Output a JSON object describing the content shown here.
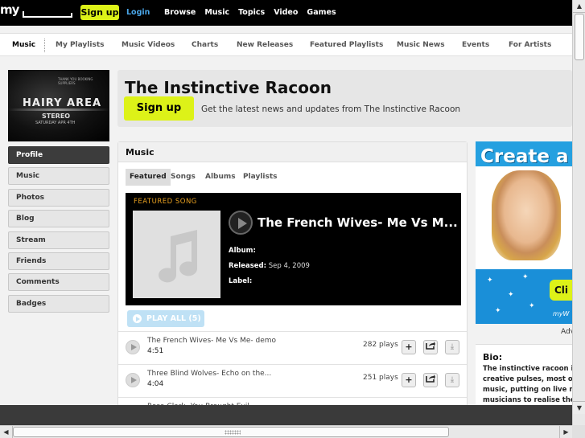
{
  "topbar": {
    "logo": "my",
    "signup_label": "Sign up",
    "login_label": "Login",
    "nav": [
      "Browse",
      "Music",
      "Topics",
      "Video",
      "Games"
    ]
  },
  "subnav": {
    "items": [
      "Music",
      "My Playlists",
      "Music Videos",
      "Charts",
      "New Releases",
      "Featured Playlists",
      "Music News",
      "Events",
      "For Artists"
    ]
  },
  "profile_image": {
    "line1": "HAIRY AREA",
    "line2": "STEREO",
    "line3": "SATURDAY APR 4TH",
    "line4": "THANK YOU BOOKING SUPPLIERS"
  },
  "sidemenu": {
    "items": [
      "Profile",
      "Music",
      "Photos",
      "Blog",
      "Stream",
      "Friends",
      "Comments",
      "Badges"
    ]
  },
  "header": {
    "artist_name": "The Instinctive Racoon",
    "signup_label": "Sign up",
    "message": "Get the latest news and updates from The Instinctive Racoon"
  },
  "music": {
    "title": "Music",
    "tabs": [
      "Featured",
      "Songs",
      "Albums",
      "Playlists"
    ],
    "featured": {
      "label": "FEATURED SONG",
      "song_title": "The French Wives- Me Vs M...",
      "album_label": "Album:",
      "album_value": "",
      "released_label": "Released:",
      "released_value": "Sep 4, 2009",
      "label_label": "Label:",
      "label_value": ""
    },
    "play_all": "PLAY ALL (5)",
    "tracks": [
      {
        "name": "The French Wives- Me Vs Me- demo",
        "duration": "4:51",
        "plays": "282 plays"
      },
      {
        "name": "Three Blind Wolves- Echo on the...",
        "duration": "4:04",
        "plays": "251 plays"
      },
      {
        "name": "Rosa Clark- You Brought Evil",
        "duration": "",
        "plays": ""
      }
    ]
  },
  "ad": {
    "headline": "Create a C",
    "button": "Cli",
    "brand": "myW",
    "label": "Adv"
  },
  "bio": {
    "title": "Bio:",
    "lines": [
      "The instinctive racoon is",
      "creative pulses, most of",
      "music, putting on live mu",
      "musicians to realise their"
    ]
  },
  "colors": {
    "accent_yellow": "#ddf218",
    "link_blue": "#4aa6e8",
    "featured_label": "#e8a020"
  }
}
